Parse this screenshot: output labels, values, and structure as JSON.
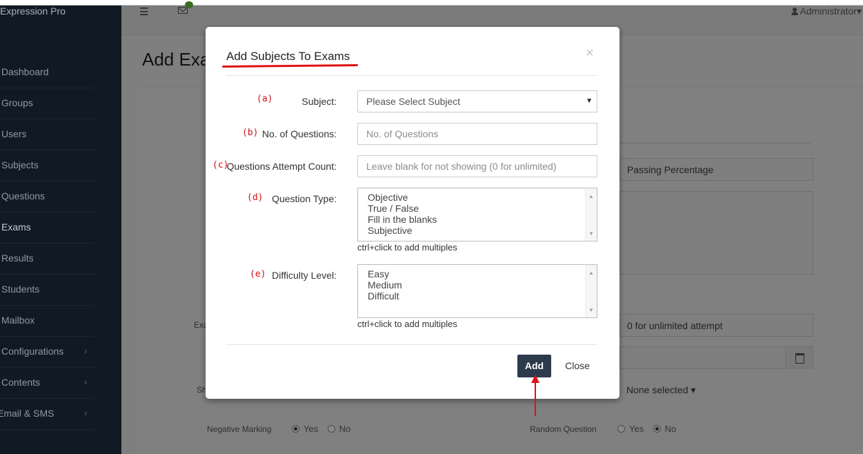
{
  "app": {
    "brand": "Expression Pro",
    "user": "Administrator",
    "page_title_visible": "Add Exa"
  },
  "sidebar": {
    "items": [
      {
        "label": "Dashboard"
      },
      {
        "label": "Groups"
      },
      {
        "label": "Users"
      },
      {
        "label": "Subjects"
      },
      {
        "label": "Questions"
      },
      {
        "label": "Exams"
      },
      {
        "label": "Results"
      },
      {
        "label": "Students"
      },
      {
        "label": "Mailbox"
      },
      {
        "label": "Configurations",
        "chevron": "›"
      },
      {
        "label": "Contents",
        "chevron": "›"
      },
      {
        "label": "Email & SMS",
        "chevron": "›"
      }
    ]
  },
  "background_form": {
    "passing_percentage_placeholder": "Passing Percentage",
    "attempt_placeholder": "0 for unlimited attempt",
    "label_exa": "Exa",
    "label_sh": "Sh",
    "none_selected": "None selected ▾",
    "negative_marking": {
      "label": "Negative Marking",
      "yes": "Yes",
      "no": "No",
      "selected": "yes"
    },
    "random_question": {
      "label": "Random Question",
      "yes": "Yes",
      "no": "No",
      "selected": "no"
    }
  },
  "modal": {
    "title": "Add Subjects To Exams",
    "close_glyph": "×",
    "fields": {
      "subject": {
        "marker": "(a)",
        "label": "Subject:",
        "value": "Please Select Subject"
      },
      "num_questions": {
        "marker": "(b)",
        "label": "No. of Questions:",
        "placeholder": "No. of Questions"
      },
      "attempt_count": {
        "marker": "(c)",
        "label": "Questions Attempt Count:",
        "placeholder": "Leave blank for not showing (0 for unlimited)"
      },
      "question_type": {
        "marker": "(d)",
        "label": "Question Type:",
        "options": [
          "Objective",
          "True / False",
          "Fill in the blanks",
          "Subjective"
        ],
        "help": "ctrl+click to add multiples"
      },
      "difficulty": {
        "marker": "(e)",
        "label": "Difficulty Level:",
        "options": [
          "Easy",
          "Medium",
          "Difficult"
        ],
        "help": "ctrl+click to add multiples"
      }
    },
    "buttons": {
      "add": "Add",
      "close": "Close"
    }
  },
  "colors": {
    "sidebar_bg": "#111a24",
    "overlay_bg": "#7f7f7f",
    "add_button": "#2c3a4c",
    "annotation_red": "#e01010"
  }
}
